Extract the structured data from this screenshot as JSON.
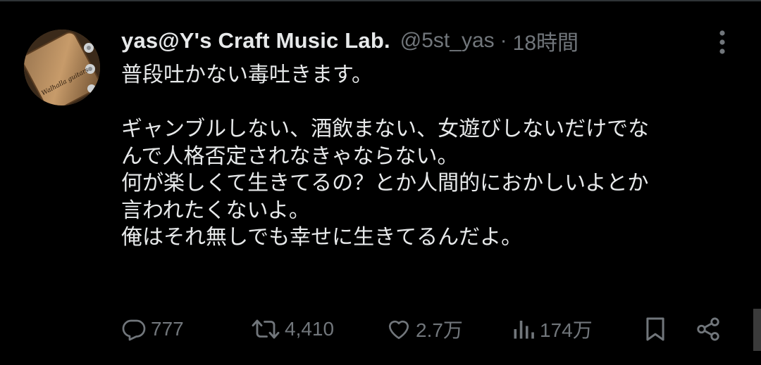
{
  "tweet": {
    "display_name": "yas@Y's Craft Music Lab.",
    "handle": "@5st_yas",
    "separator": "·",
    "time": "18時間",
    "avatar_text": "Walhalla guitars",
    "lines": [
      "普段吐かない毒吐きます。",
      "",
      "ギャンブルしない、酒飲まない、女遊びしないだけでな",
      "んで人格否定されなきゃならない。",
      "何が楽しくて生きてるの？とか人間的におかしいよとか",
      "言われたくないよ。",
      "俺はそれ無しでも幸せに生きてるんだよ。"
    ]
  },
  "actions": {
    "reply": {
      "icon": "reply-icon",
      "count": "777"
    },
    "retweet": {
      "icon": "retweet-icon",
      "count": "4,410"
    },
    "like": {
      "icon": "heart-icon",
      "count": "2.7万"
    },
    "views": {
      "icon": "analytics-icon",
      "count": "174万"
    },
    "bookmark": {
      "icon": "bookmark-icon"
    },
    "share": {
      "icon": "share-icon"
    }
  },
  "colors": {
    "background": "#000000",
    "text_primary": "#e7e9ea",
    "text_secondary": "#71767b"
  }
}
